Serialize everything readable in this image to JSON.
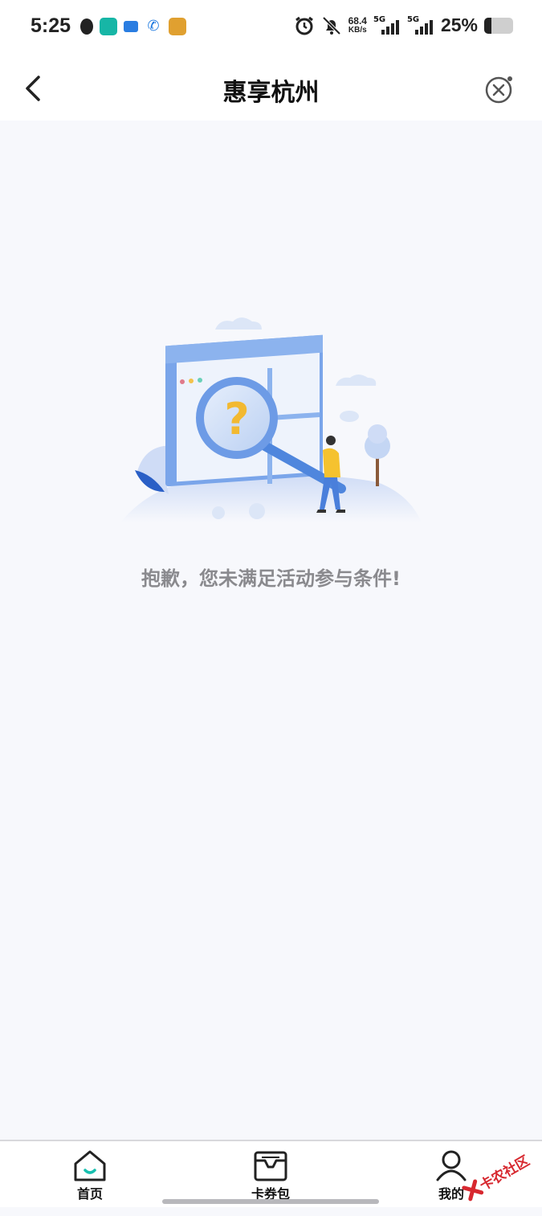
{
  "status_bar": {
    "time": "5:25",
    "network_speed": "68.4",
    "network_speed_unit": "KB/s",
    "sim1_label": "5G",
    "sim2_label": "5G",
    "battery_percent": "25%",
    "battery_level": 0.25,
    "notification_icons": [
      "qq-icon",
      "boss-zhipin-icon",
      "message-icon",
      "telecom-icon",
      "game-icon"
    ]
  },
  "nav": {
    "title": "惠享杭州",
    "back_icon": "chevron-left-icon",
    "close_icon": "close-circle-icon"
  },
  "empty_state": {
    "message": "抱歉，您未满足活动参与条件!",
    "illustration": "magnifier-question-illustration"
  },
  "tab_bar": {
    "items": [
      {
        "label": "首页",
        "icon": "home-icon"
      },
      {
        "label": "卡券包",
        "icon": "wallet-icon"
      },
      {
        "label": "我的",
        "icon": "user-icon"
      }
    ]
  },
  "watermark": {
    "text": "卡农社区"
  },
  "colors": {
    "page_background": "#f7f8fc",
    "accent_teal": "#18c0b0",
    "message_gray": "#8a8a8e",
    "illustration_blue": "#5b8fe0"
  }
}
